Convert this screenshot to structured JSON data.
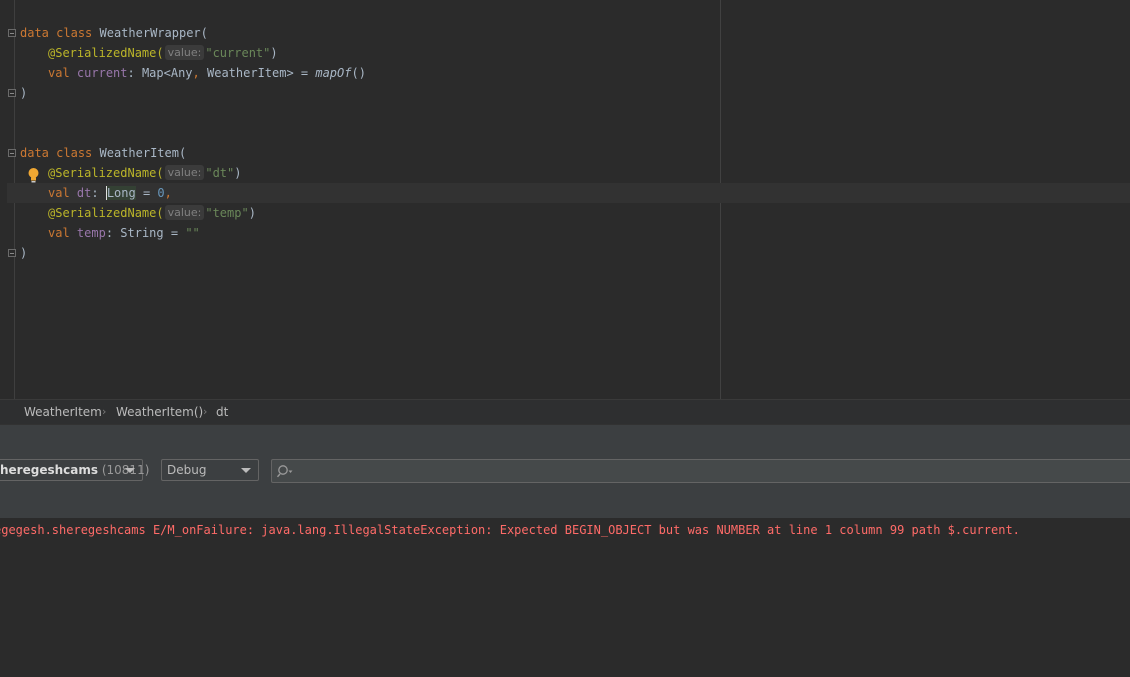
{
  "editor": {
    "lines": {
      "l1": {
        "kw1": "data",
        "kw2": "class",
        "name": "WeatherWrapper("
      },
      "l2": {
        "annotation": "@SerializedName(",
        "hint": "value:",
        "string": "\"current\"",
        "close": ")"
      },
      "l3": {
        "kw": "val",
        "prop": "current",
        "type": ": Map<Any",
        "comma": ",",
        "type2": " WeatherItem> = ",
        "fn": "mapOf",
        "end": "()"
      },
      "l4": {
        "close": ")"
      },
      "l5": {
        "kw1": "data",
        "kw2": "class",
        "name": "WeatherItem("
      },
      "l6": {
        "annotation": "@SerializedName(",
        "hint": "value:",
        "string": "\"dt\"",
        "close": ")"
      },
      "l7": {
        "kw": "val",
        "prop": "dt",
        "colon": ": ",
        "type": "Long",
        "eq": " = ",
        "num": "0",
        "comma": ","
      },
      "l8": {
        "annotation": "@SerializedName(",
        "hint": "value:",
        "string": "\"temp\"",
        "close": ")"
      },
      "l9": {
        "kw": "val",
        "prop": "temp",
        "type": ": String = ",
        "string": "\"\""
      },
      "l10": {
        "close": ")"
      }
    }
  },
  "breadcrumb": {
    "items": [
      "WeatherItem",
      "WeatherItem()",
      "dt"
    ],
    "separator": "›"
  },
  "logcat": {
    "process": {
      "name": "heregeshcams",
      "pid": "(10811)"
    },
    "level": "Debug",
    "search": {
      "value": "",
      "placeholder": ""
    },
    "log_line": "egegesh.sheregeshcams E/M_onFailure: java.lang.IllegalStateException: Expected BEGIN_OBJECT but was NUMBER at line 1 column 99 path $.current."
  },
  "colors": {
    "keyword": "#cc7832",
    "annotation": "#bbb529",
    "string": "#6a8759",
    "number": "#6897bb",
    "property": "#9876aa",
    "error": "#ff6b68",
    "background": "#2b2b2b"
  }
}
